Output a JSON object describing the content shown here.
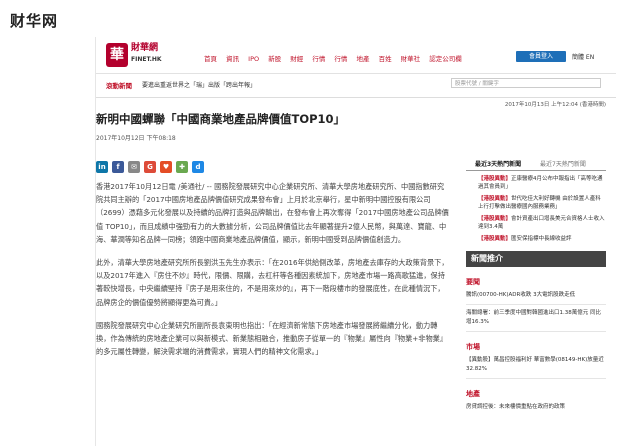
{
  "site_title": "财华网",
  "header": {
    "logo_glyph": "華",
    "logo_name": "財華網",
    "logo_sub": "FINET.HK",
    "nav": [
      "首頁",
      "資訊",
      "IPO",
      "新股",
      "財經",
      "行情",
      "行情",
      "地產",
      "百姓",
      "財華社",
      "認定公司欄"
    ],
    "login": "會員登入",
    "lang": "簡體 EN"
  },
  "subbar": {
    "hot_label": "滾動新聞",
    "hot_text": "要進出重返世界之「瑞」出版「跨出年報」",
    "search_placeholder": "股票代號 / 關鍵字"
  },
  "dateline": "2017年10月13日 上午12:04 (香港時間)",
  "article": {
    "title": "新明中國蟬聯「中國商業地產品牌價值TOP10」",
    "date": "2017年10月12日 下午08:18",
    "share": [
      "in",
      "f",
      "✉",
      "G",
      "♥",
      "✚",
      "d"
    ],
    "paragraphs": [
      "香港2017年10月12日電 /美通社/ -- 國務院發展研究中心企業研究所、清華大學房地產研究所、中國指數研究院共同主辦的「2017中國房地產品牌價值研究成果發布會」上月於北京舉行，星中新明中國控股有限公司（2699）憑藉多元化發展以及持續的品牌打造與品牌輸出，在發布會上再次奪得「2017中國房地產公司品牌價值 TOP10」，而且成績中強勁有力的大數據分析，公司品牌價值比去年顯著提升2億人民幣，與萬達、寶龍、中海、華潤等知名品牌一同榜；領跑中國商業地產品牌價值，顯示，新明中國受到品牌價值創造力。",
      "此外，清華大學房地產研究所所長劉洪玉先生亦表示：「在2016年供給側改革，房地產去庫存的大政策背景下，以及2017年進入『房住不炒』時代，限價、限購，去杠杆等各種因素統加下，房地產市場一路高歌猛進，保持著較快增長，中央繼續堅持『房子是用來住的，不是用來炒的』，再下一階段樓市的發展底性，在此種情況下，品牌房企的價值優勢將顯得更為可貴。」",
      "國務院發展研究中心企業研究所副所長袁東明也指出：「在經濟新常態下房地產市場發展將繼續分化，動力轉換，作為傳統的房地產企業可以與新模式、新業態相融合，推動房子從單一的『物業』屬性向『物業+非物業』的多元屬性轉變，解決需求端的消費需求，實現人們的精神文化需求。」"
    ]
  },
  "sidebar": {
    "tab_hot": "最近3天熱門新聞",
    "tab_other": "最近7天熱門新聞",
    "hot_items": [
      {
        "tag": "【港股異動】",
        "text": "正康醫療4月公布中報指出「高等吃通過其會員到」"
      },
      {
        "tag": "【港股異動】",
        "text": "世代吃佳大利好轉機 由於設置人產科上行打擊做出醫療國內服務業務」"
      },
      {
        "tag": "【港股異動】",
        "text": "會計資產出口增長美元合資格人士收入達到3.4萬"
      },
      {
        "tag": "【港股異動】",
        "text": "匯安保指標中長線收益評"
      }
    ],
    "news_head": "新聞推介",
    "categories": [
      {
        "name": "要聞",
        "item": "騰訊(00700-HK)ADR收跌 3大電訊股跌走低"
      },
      {
        "name": "",
        "item": "海關總署：前三季度中國對韓國進出口1.38萬億元 同比增16.3%"
      },
      {
        "name": "市場",
        "item": "【異動股】萬昌控股福利好 華富數學(08149-HK)放量近32.82%"
      },
      {
        "name": "地產",
        "item": "房貸調控後：未來樓價重點在政府的政策"
      }
    ]
  }
}
